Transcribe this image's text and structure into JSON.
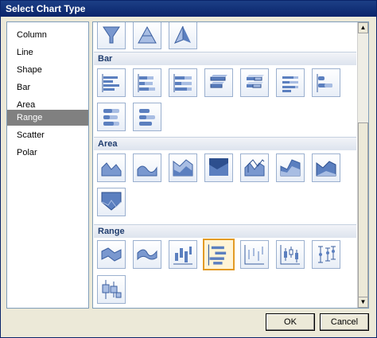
{
  "window": {
    "title": "Select Chart Type"
  },
  "sidebar": {
    "items": [
      {
        "label": "Column",
        "selected": false
      },
      {
        "label": "Line",
        "selected": false
      },
      {
        "label": "Shape",
        "selected": false
      },
      {
        "label": "Bar",
        "selected": false
      },
      {
        "label": "Area",
        "selected": false
      },
      {
        "label": "Range",
        "selected": true
      },
      {
        "label": "Scatter",
        "selected": false
      },
      {
        "label": "Polar",
        "selected": false
      }
    ]
  },
  "gallery": {
    "sections": [
      {
        "title": "Bar",
        "icons": [
          "bar-clustered-icon",
          "bar-stacked-icon",
          "bar-100-stacked-icon",
          "bar-3d-clustered-icon",
          "bar-3d-stacked-icon",
          "bar-3d-100-stacked-icon",
          "bar-cylinder-icon",
          "bar-cylinder-stacked-icon",
          "bar-cylinder-100-icon"
        ]
      },
      {
        "title": "Area",
        "icons": [
          "area-icon",
          "area-smooth-icon",
          "area-stacked-icon",
          "area-100-icon",
          "area-3d-icon",
          "area-3d-stacked-icon",
          "area-3d-100-icon",
          "area-funnel-icon"
        ]
      },
      {
        "title": "Range",
        "icons": [
          "range-area-icon",
          "range-smooth-area-icon",
          "range-column-icon",
          "range-bar-icon",
          "stock-icon",
          "candlestick-icon",
          "error-bar-icon",
          "boxplot-icon"
        ],
        "selected_index": 3
      }
    ],
    "top_row_icons": [
      "funnel-icon",
      "pyramid-icon",
      "pyramid-3d-icon"
    ]
  },
  "buttons": {
    "ok": "OK",
    "cancel": "Cancel"
  },
  "colors": {
    "accent": "#4a6fb5",
    "tile_border": "#9bb0cf",
    "selection": "#e39b25",
    "section_text": "#1f3c6e",
    "list_selected": "#808080"
  }
}
